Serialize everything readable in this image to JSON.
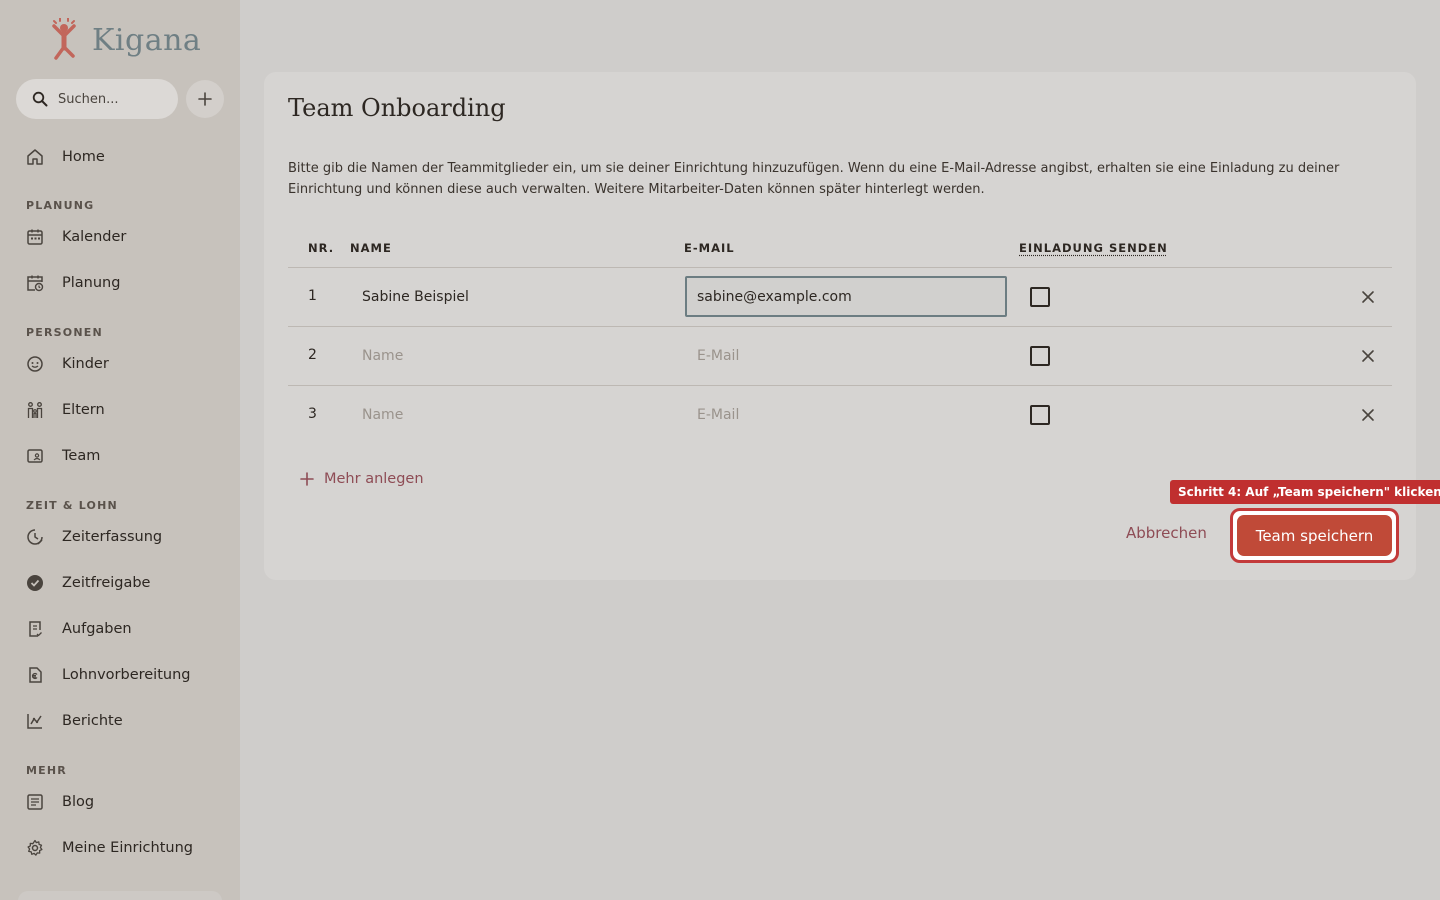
{
  "brand": {
    "name": "Kigana"
  },
  "search": {
    "placeholder": "Suchen..."
  },
  "nav": {
    "home": "Home",
    "sections": {
      "planung": "PLANUNG",
      "personen": "PERSONEN",
      "zeit_lohn": "ZEIT & LOHN",
      "mehr": "MEHR"
    },
    "items": {
      "kalender": "Kalender",
      "planung": "Planung",
      "kinder": "Kinder",
      "eltern": "Eltern",
      "team": "Team",
      "zeiterfassung": "Zeiterfassung",
      "zeitfreigabe": "Zeitfreigabe",
      "aufgaben": "Aufgaben",
      "lohnvorbereitung": "Lohnvorbereitung",
      "berichte": "Berichte",
      "blog": "Blog",
      "meine_einrichtung": "Meine Einrichtung"
    }
  },
  "card": {
    "title": "Team Onboarding",
    "description": "Bitte gib die Namen der Teammitglieder ein, um sie deiner Einrichtung hinzuzufügen. Wenn du eine E-Mail-Adresse angibst, erhalten sie eine Einladung zu deiner Einrichtung und können diese auch verwalten. Weitere Mitarbeiter-Daten können später hinterlegt werden.",
    "columns": {
      "nr": "NR.",
      "name": "NAME",
      "email": "E-MAIL",
      "invite": "EINLADUNG SENDEN"
    },
    "rows": [
      {
        "nr": "1",
        "name": "Sabine Beispiel",
        "email": "sabine@example.com",
        "name_placeholder": "Name",
        "email_placeholder": "E-Mail",
        "invite": false
      },
      {
        "nr": "2",
        "name": "",
        "email": "",
        "name_placeholder": "Name",
        "email_placeholder": "E-Mail",
        "invite": false
      },
      {
        "nr": "3",
        "name": "",
        "email": "",
        "name_placeholder": "Name",
        "email_placeholder": "E-Mail",
        "invite": false
      }
    ],
    "more_label": "Mehr anlegen",
    "cancel_label": "Abbrechen",
    "save_label": "Team speichern"
  },
  "tutorial": {
    "step_label": "Schritt 4: Auf „Team speichern\" klicken"
  },
  "colors": {
    "accent": "#c04a38",
    "link": "#8e4c55",
    "highlight": "#c02f2f",
    "sidebar_bg": "#c7c2bc",
    "page_bg": "#cfcdcb"
  }
}
